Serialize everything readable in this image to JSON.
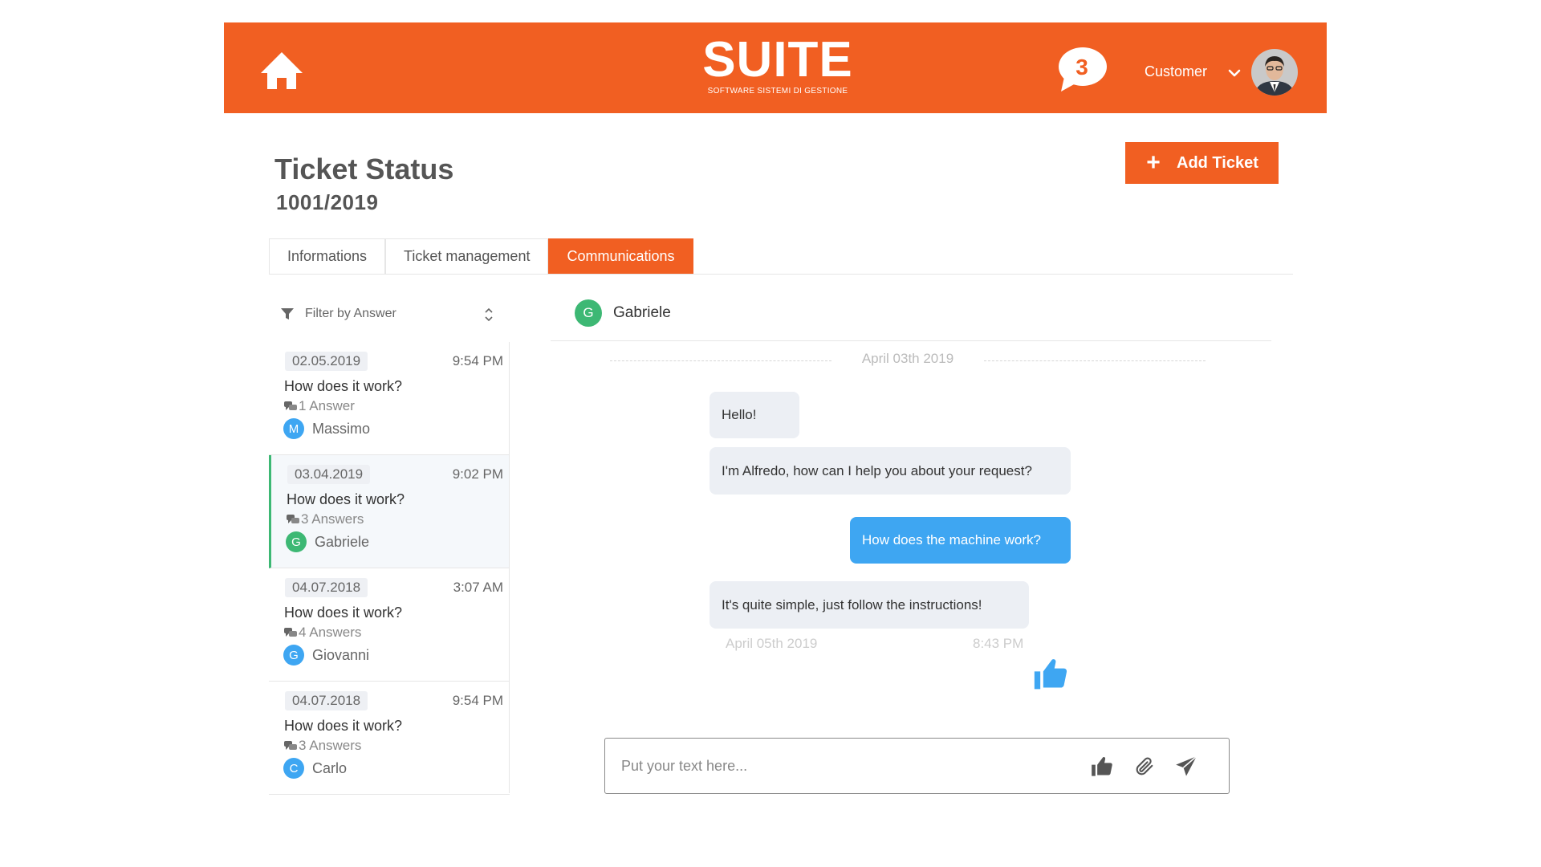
{
  "header": {
    "logo_main": "SUITE",
    "logo_sub": "SOFTWARE SISTEMI DI GESTIONE",
    "notifications_count": "3",
    "user_name": "Customer",
    "brand_color": "#f15f22"
  },
  "page": {
    "title": "Ticket Status",
    "ticket_id": "1001/2019",
    "add_button_label": "Add Ticket"
  },
  "tabs": [
    {
      "label": "Informations",
      "active": false
    },
    {
      "label": "Ticket management",
      "active": false
    },
    {
      "label": "Communications",
      "active": true
    }
  ],
  "filter": {
    "label": "Filter by Answer"
  },
  "threads": [
    {
      "date": "02.05.2019",
      "time": "9:54 PM",
      "title": "How does it work?",
      "answers": "1 Answer",
      "user": "Massimo",
      "initial": "M",
      "color": "#3ea6f2",
      "selected": false
    },
    {
      "date": "03.04.2019",
      "time": "9:02 PM",
      "title": "How does it work?",
      "answers": "3 Answers",
      "user": "Gabriele",
      "initial": "G",
      "color": "#3db874",
      "selected": true
    },
    {
      "date": "04.07.2018",
      "time": "3:07 AM",
      "title": "How does it work?",
      "answers": "4 Answers",
      "user": "Giovanni",
      "initial": "G",
      "color": "#3ea6f2",
      "selected": false
    },
    {
      "date": "04.07.2018",
      "time": "9:54 PM",
      "title": "How does it work?",
      "answers": "3 Answers",
      "user": "Carlo",
      "initial": "C",
      "color": "#3ea6f2",
      "selected": false
    }
  ],
  "chat": {
    "contact_name": "Gabriele",
    "contact_initial": "G",
    "contact_color": "#3db874",
    "date_separator": "April 03th 2019",
    "messages": [
      {
        "text": "Hello!",
        "direction": "in"
      },
      {
        "text": "I'm Alfredo, how can I help you about your request?",
        "direction": "in"
      },
      {
        "text": "How does the machine work?",
        "direction": "out"
      },
      {
        "text": "It's quite simple, just follow the instructions!",
        "direction": "in"
      }
    ],
    "last_date": "April 05th 2019",
    "last_time": "8:43 PM",
    "composer_placeholder": "Put your text here..."
  },
  "icons": {
    "home": "home-icon",
    "notifications": "chat-bubble-icon",
    "chevron": "chevron-down-icon",
    "add": "plus-icon",
    "filter": "funnel-icon",
    "sort": "sort-icon",
    "answers": "comments-icon",
    "like": "thumbs-up-icon",
    "attach": "paperclip-icon",
    "send": "send-icon"
  }
}
